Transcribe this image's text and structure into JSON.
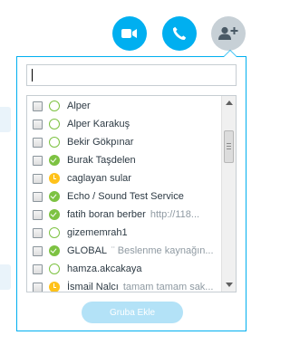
{
  "header": {
    "video_call_icon": "video-camera-icon",
    "audio_call_icon": "phone-icon",
    "add_people_icon": "add-person-icon",
    "colors": {
      "accent": "#00aff0",
      "inactive": "#c7d0d6"
    }
  },
  "popup": {
    "search": {
      "value": "",
      "placeholder": ""
    },
    "contacts": [
      {
        "name": "Alper",
        "mood": "",
        "status": "offline"
      },
      {
        "name": "Alper Karakuş",
        "mood": "",
        "status": "offline"
      },
      {
        "name": "Bekir  Gökpınar",
        "mood": "",
        "status": "offline"
      },
      {
        "name": "Burak  Taşdelen",
        "mood": "",
        "status": "online"
      },
      {
        "name": "caglayan sular",
        "mood": "",
        "status": "away"
      },
      {
        "name": "Echo / Sound Test Service",
        "mood": "",
        "status": "online"
      },
      {
        "name": "fatih boran berber",
        "mood": "http://118...",
        "status": "online"
      },
      {
        "name": "gizememrah1",
        "mood": "",
        "status": "offline"
      },
      {
        "name": "GLOBAL",
        "mood": "¨ Beslenme kaynağın...",
        "status": "online"
      },
      {
        "name": "hamza.akcakaya",
        "mood": "",
        "status": "offline"
      },
      {
        "name": "İsmail Nalcı",
        "mood": "tamam tamam sak...",
        "status": "away"
      }
    ],
    "add_button_label": "Gruba Ekle"
  }
}
